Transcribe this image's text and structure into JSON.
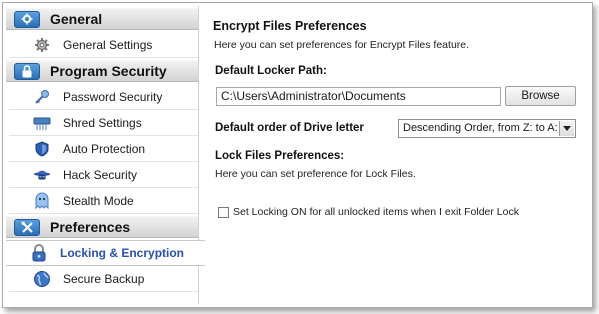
{
  "sidebar": {
    "sections": [
      {
        "label": "General",
        "icon": "gear-box-icon"
      },
      {
        "label": "Program Security",
        "icon": "lock-icon"
      },
      {
        "label": "Preferences",
        "icon": "wrench-screwdriver-icon"
      }
    ],
    "items": [
      {
        "label": "General Settings",
        "icon": "gear-icon"
      },
      {
        "label": "Password Security",
        "icon": "key-icon"
      },
      {
        "label": "Shred Settings",
        "icon": "shredder-icon"
      },
      {
        "label": "Auto Protection",
        "icon": "shield-icon"
      },
      {
        "label": "Hack Security",
        "icon": "hacker-icon"
      },
      {
        "label": "Stealth Mode",
        "icon": "ghost-icon"
      },
      {
        "label": "Locking & Encryption",
        "icon": "padlock-icon",
        "active": true
      },
      {
        "label": "Secure Backup",
        "icon": "globe-icon"
      }
    ]
  },
  "main": {
    "encrypt_title": "Encrypt Files Preferences",
    "encrypt_desc": "Here you can set preferences for Encrypt Files feature.",
    "locker_path_label": "Default Locker Path:",
    "locker_path_value": "C:\\Users\\Administrator\\Documents",
    "browse_label": "Browse",
    "drive_order_label": "Default order of Drive letter",
    "drive_order_value": "Descending Order, from Z: to A:",
    "lock_title": "Lock Files Preferences:",
    "lock_desc": "Here you can set preference for Lock Files.",
    "checkbox_label": "Set Locking ON for all unlocked items when I exit Folder Lock",
    "checkbox_checked": false
  },
  "colors": {
    "active_item": "#2a52a8",
    "header_icon": "#2a6fb5"
  }
}
